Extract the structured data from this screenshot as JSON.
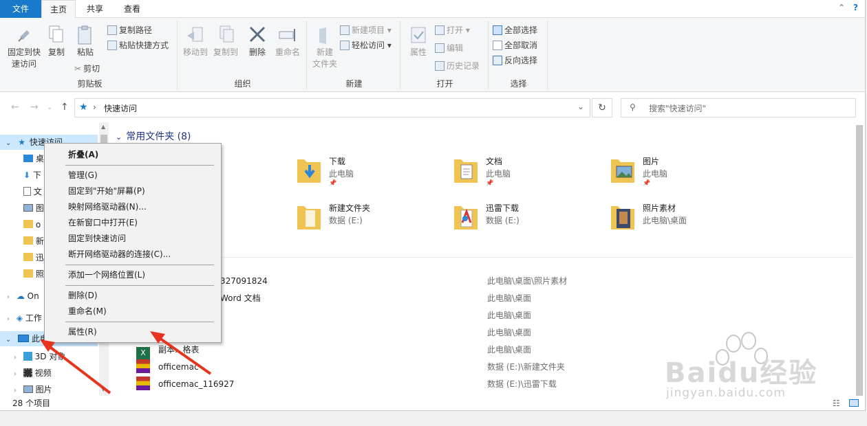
{
  "ribbon_tabs": {
    "file": "文件",
    "home": "主页",
    "share": "共享",
    "view": "查看"
  },
  "ribbon": {
    "clipboard": {
      "label": "剪贴板",
      "pin_quick": "固定到快\n速访问",
      "copy": "复制",
      "paste": "粘贴",
      "copy_path": "复制路径",
      "paste_shortcut": "粘贴快捷方式",
      "cut": "剪切"
    },
    "organize": {
      "label": "组织",
      "move_to": "移动到",
      "copy_to": "复制到",
      "delete": "删除",
      "rename": "重命名"
    },
    "new": {
      "label": "新建",
      "new_folder": "新建\n文件夹",
      "new_item": "新建项目",
      "easy_access": "轻松访问"
    },
    "open": {
      "label": "打开",
      "properties": "属性",
      "open": "打开",
      "edit": "编辑",
      "history": "历史记录"
    },
    "select": {
      "label": "选择",
      "select_all": "全部选择",
      "select_none": "全部取消",
      "invert": "反向选择"
    }
  },
  "address": {
    "path": "快速访问",
    "search_placeholder": "搜索\"快速访问\""
  },
  "nav": {
    "quick_access": "快速访问",
    "items_partial": [
      "桌",
      "下",
      "文",
      "图",
      "o",
      "新",
      "迅",
      "照"
    ],
    "onedrive": "On",
    "work": "工作",
    "this_pc": "此电脑",
    "objects3d": "3D 对象",
    "videos": "视频",
    "pictures": "图片"
  },
  "content": {
    "group_header": "常用文件夹 (8)",
    "tiles": [
      {
        "name": "下载",
        "sub": "此电脑",
        "pinned": true
      },
      {
        "name": "文档",
        "sub": "此电脑",
        "pinned": true
      },
      {
        "name": "图片",
        "sub": "此电脑",
        "pinned": true
      },
      {
        "name": "新建文件夹",
        "sub": "数据 (E:)",
        "pinned": false
      },
      {
        "name": "迅雷下载",
        "sub": "数据 (E:)",
        "pinned": false
      },
      {
        "name": "照片素材",
        "sub": "此电脑\\桌面",
        "pinned": false
      }
    ],
    "recent": [
      {
        "name": "327091824",
        "loc": "此电脑\\桌面\\照片素材"
      },
      {
        "name": "Word 文档",
        "loc": "此电脑\\桌面"
      },
      {
        "name": "",
        "loc": "此电脑\\桌面"
      },
      {
        "name": "",
        "loc": "此电脑\\桌面"
      },
      {
        "name": "副本.. 格表",
        "loc": "此电脑\\桌面"
      },
      {
        "name": "officemac",
        "loc": "数据 (E:)\\新建文件夹"
      },
      {
        "name": "officemac_116927",
        "loc": "数据 (E:)\\迅雷下载"
      }
    ]
  },
  "status": {
    "count": "28 个项目"
  },
  "context_menu": {
    "collapse": "折叠(A)",
    "manage": "管理(G)",
    "pin_start": "固定到\"开始\"屏幕(P)",
    "map_drive": "映射网络驱动器(N)...",
    "open_new_window": "在新窗口中打开(E)",
    "pin_quick": "固定到快速访问",
    "disconnect": "断开网络驱动器的连接(C)...",
    "add_network": "添加一个网络位置(L)",
    "delete": "删除(D)",
    "rename": "重命名(M)",
    "properties": "属性(R)"
  },
  "watermark": {
    "brand": "Baidu经验",
    "url": "jingyan.baidu.com"
  },
  "colors": {
    "accent": "#1979ca",
    "selection": "#cce8ff",
    "arrow": "#e8331f",
    "folder": "#f0c452"
  }
}
